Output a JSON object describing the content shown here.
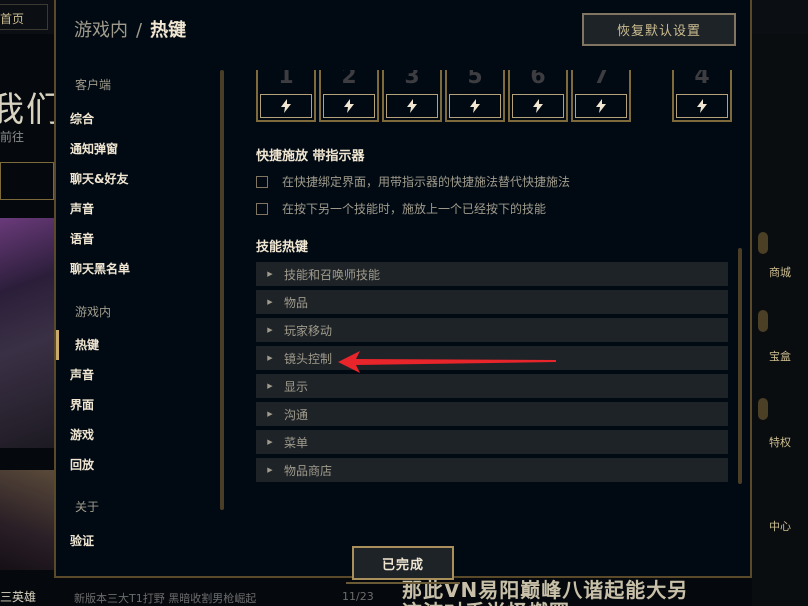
{
  "background": {
    "home_tab": "首页",
    "big_text": "我们",
    "go_text": "前往",
    "hero_text": "三英雄",
    "news_text": "新版本三大T1打野 黑暗收割男枪崛起",
    "news_date": "11/23",
    "promo_line1": "那此VN易阳巅峰八谐起能大另",
    "promo_line2": "这波对手尚怪燃圈",
    "right_items": [
      "商城",
      "宝盒",
      "特权",
      "中心"
    ]
  },
  "header": {
    "breadcrumb_parent": "游戏内",
    "breadcrumb_sep": "/",
    "breadcrumb_current": "热键",
    "restore_defaults_label": "恢复默认设置"
  },
  "sidebar": {
    "client_group": "客户端",
    "client_items": [
      "综合",
      "通知弹窗",
      "聊天&好友",
      "声音",
      "语音",
      "聊天黑名单"
    ],
    "ingame_group": "游戏内",
    "ingame_items": [
      "热键",
      "声音",
      "界面",
      "游戏",
      "回放"
    ],
    "about_group": "关于",
    "about_items": [
      "验证"
    ],
    "active_item": "热键"
  },
  "item_slots": {
    "numbers": [
      "1",
      "2",
      "3",
      "5",
      "6",
      "7",
      "4"
    ],
    "key_icon": "lightning-bolt-icon"
  },
  "quick_cast": {
    "title": "快捷施放 带指示器",
    "options": [
      {
        "label": "在快捷绑定界面，用带指示器的快捷施法替代快捷施法",
        "checked": false
      },
      {
        "label": "在按下另一个技能时，施放上一个已经按下的技能",
        "checked": false
      }
    ]
  },
  "ability_hotkeys": {
    "title": "技能热键",
    "sections": [
      "技能和召唤师技能",
      "物品",
      "玩家移动",
      "镜头控制",
      "显示",
      "沟通",
      "菜单",
      "物品商店"
    ]
  },
  "annotation": {
    "arrow_color": "#e8252a",
    "points_to": "镜头控制"
  },
  "footer": {
    "done_label": "已完成"
  }
}
